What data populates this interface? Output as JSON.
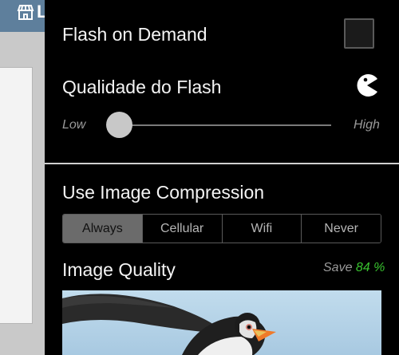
{
  "background_app": {
    "header_text": "L",
    "header_color": "#5e7f9c"
  },
  "settings": {
    "flash_on_demand": {
      "label": "Flash on Demand",
      "checked": false
    },
    "flash_quality": {
      "label": "Qualidade do Flash",
      "low_label": "Low",
      "high_label": "High",
      "value": 0.0,
      "icon": "pacman-icon"
    },
    "image_compression": {
      "label": "Use Image Compression",
      "options": [
        "Always",
        "Cellular",
        "Wifi",
        "Never"
      ],
      "selected": "Always"
    },
    "image_quality": {
      "label": "Image Quality",
      "save_label": "Save",
      "save_value": "84 %",
      "preview_subject": "puffin-image"
    }
  },
  "colors": {
    "drawer_bg": "#000000",
    "accent_green": "#39c42f",
    "segment_active": "#6b6b6b"
  }
}
